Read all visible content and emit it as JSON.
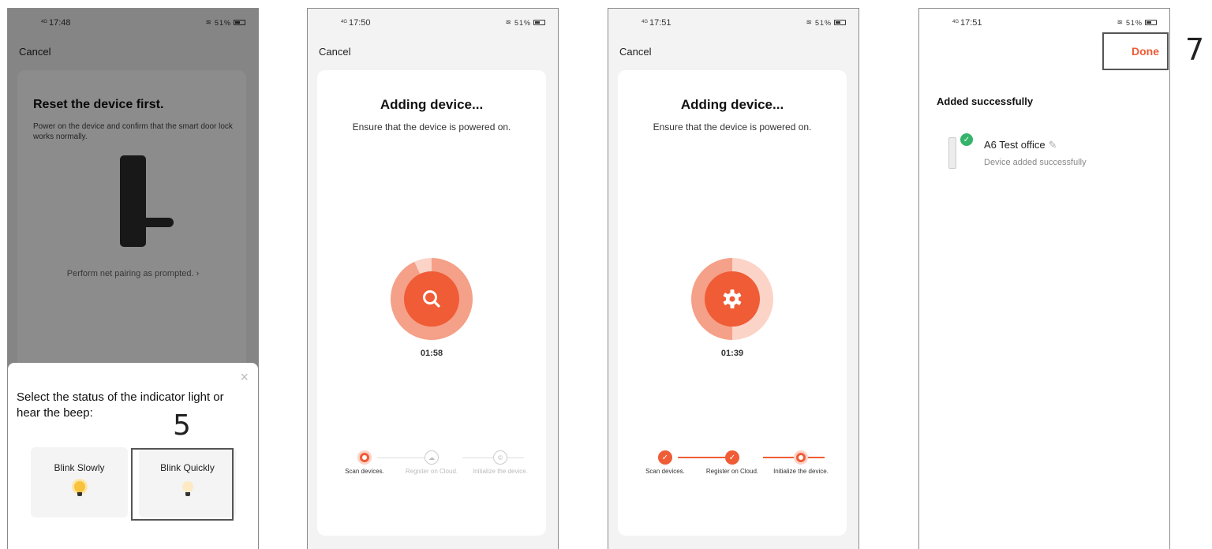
{
  "screens": [
    {
      "status_time": "17:48",
      "status_signal": "4G",
      "status_battery": "51%",
      "cancel_label": "Cancel",
      "title": "Reset the device first.",
      "description": "Power on the device and confirm that the smart door lock works normally.",
      "pair_link": "Perform net pairing as prompted. ›",
      "sheet_question": "Select the status of the indicator light or hear the beep:",
      "close_icon": "×",
      "options": [
        {
          "label": "Blink Slowly",
          "icon": "bulb-on-icon"
        },
        {
          "label": "Blink Quickly",
          "icon": "bulb-dim-icon"
        }
      ],
      "step_number": "5"
    },
    {
      "status_time": "17:50",
      "status_signal": "4G",
      "status_battery": "51%",
      "cancel_label": "Cancel",
      "title": "Adding device...",
      "subtitle": "Ensure that the device is powered on.",
      "timer": "01:58",
      "center_icon": "search-icon",
      "steps": [
        {
          "label": "Scan devices.",
          "state": "current"
        },
        {
          "label": "Register on Cloud.",
          "state": "todo"
        },
        {
          "label": "Initialize the device.",
          "state": "todo"
        }
      ]
    },
    {
      "status_time": "17:51",
      "status_signal": "4G",
      "status_battery": "51%",
      "cancel_label": "Cancel",
      "title": "Adding device...",
      "subtitle": "Ensure that the device is powered on.",
      "timer": "01:39",
      "center_icon": "gear-icon",
      "steps": [
        {
          "label": "Scan devices.",
          "state": "done"
        },
        {
          "label": "Register on Cloud.",
          "state": "done"
        },
        {
          "label": "Initialize the device.",
          "state": "current"
        }
      ]
    },
    {
      "status_time": "17:51",
      "status_signal": "4G",
      "status_battery": "51%",
      "done_label": "Done",
      "added_title": "Added successfully",
      "device_name": "A6 Test office",
      "device_status": "Device added successfully",
      "step_number": "7"
    }
  ],
  "colors": {
    "accent": "#ef5c36",
    "success": "#34b36b",
    "background": "#f3f3f3"
  }
}
